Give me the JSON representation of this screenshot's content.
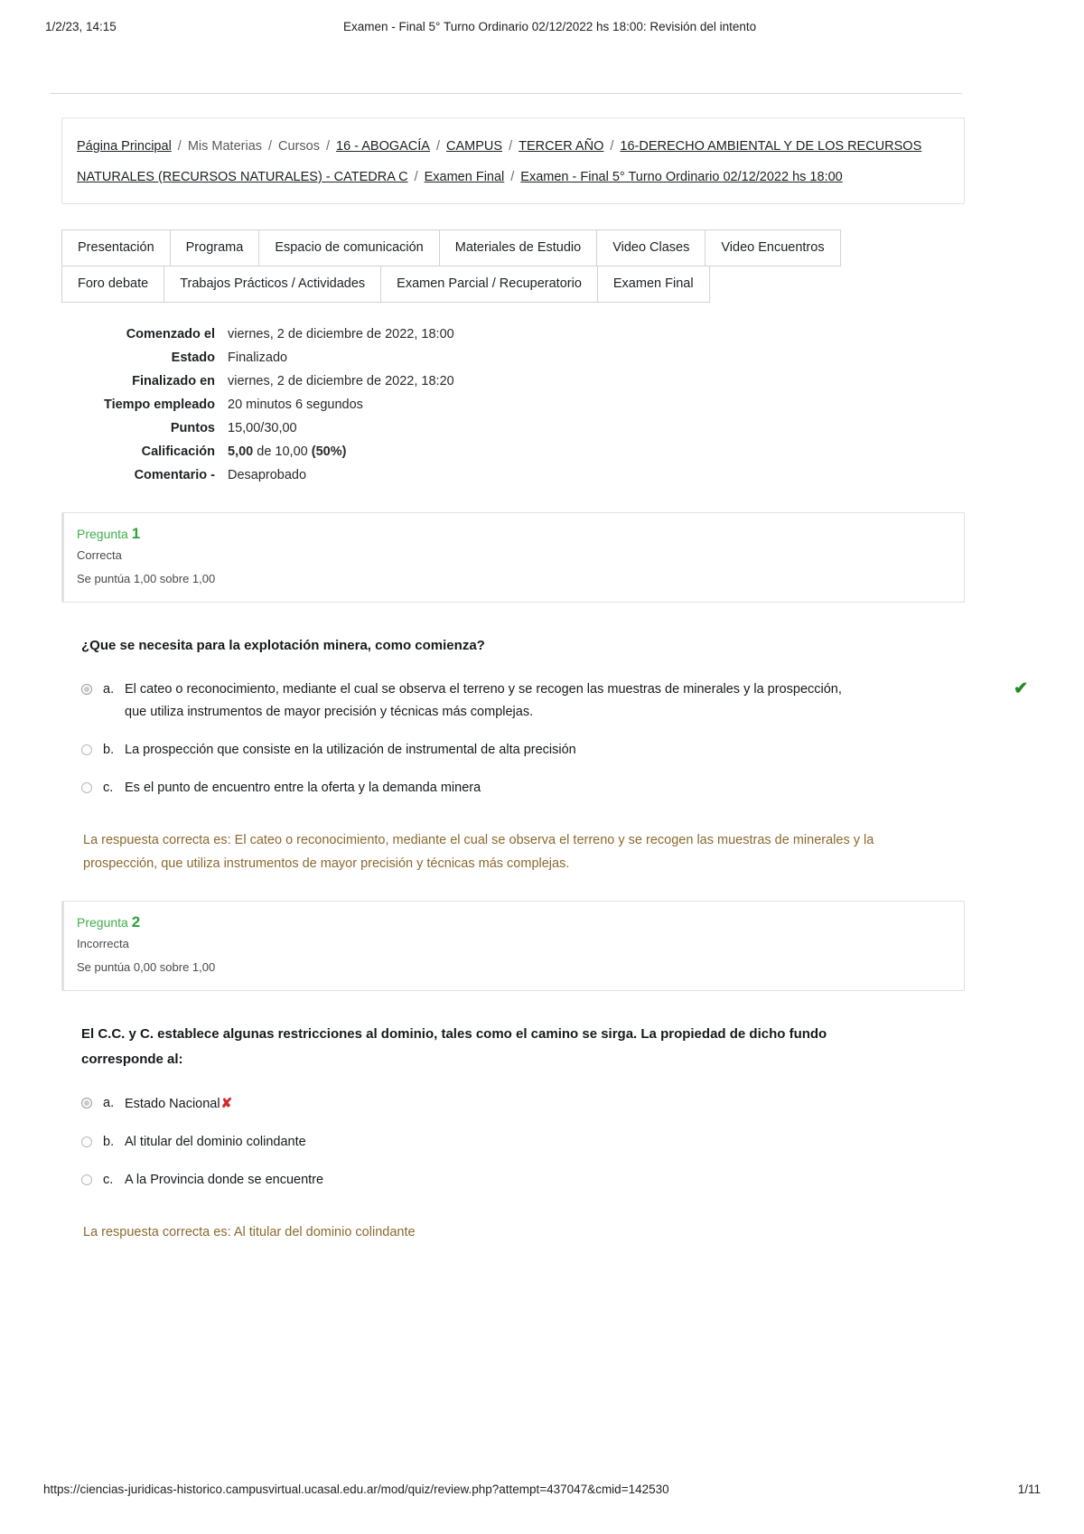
{
  "print": {
    "date": "1/2/23, 14:15",
    "title": "Examen - Final 5° Turno Ordinario 02/12/2022 hs 18:00: Revisión del intento",
    "url": "https://ciencias-juridicas-historico.campusvirtual.ucasal.edu.ar/mod/quiz/review.php?attempt=437047&cmid=142530",
    "page": "1/11"
  },
  "breadcrumb": {
    "items": [
      {
        "label": "Página Principal",
        "link": true
      },
      {
        "label": "Mis Materias",
        "link": false
      },
      {
        "label": "Cursos",
        "link": false
      },
      {
        "label": "16 - ABOGACÍA",
        "link": true
      },
      {
        "label": "CAMPUS",
        "link": true
      },
      {
        "label": "TERCER AÑO",
        "link": true
      },
      {
        "label": "16-DERECHO AMBIENTAL Y DE LOS RECURSOS NATURALES (RECURSOS NATURALES) - CATEDRA C",
        "link": true
      },
      {
        "label": "Examen Final",
        "link": true
      },
      {
        "label": "Examen - Final 5° Turno Ordinario 02/12/2022 hs 18:00",
        "link": true
      }
    ],
    "separator": "/"
  },
  "tabs": {
    "row1": [
      "Presentación",
      "Programa",
      "Espacio de comunicación",
      "Materiales de Estudio",
      "Video Clases",
      "Video Encuentros"
    ],
    "row2": [
      "Foro debate",
      "Trabajos Prácticos / Actividades",
      "Examen Parcial / Recuperatorio",
      "Examen Final"
    ]
  },
  "summary": {
    "rows": [
      {
        "label": "Comenzado el",
        "value": "viernes, 2 de diciembre de 2022, 18:00"
      },
      {
        "label": "Estado",
        "value": "Finalizado"
      },
      {
        "label": "Finalizado en",
        "value": "viernes, 2 de diciembre de 2022, 18:20"
      },
      {
        "label": "Tiempo empleado",
        "value": "20 minutos 6 segundos"
      },
      {
        "label": "Puntos",
        "value": "15,00/30,00"
      }
    ],
    "calificacion": {
      "label": "Calificación",
      "score": "5,00",
      "of": "de 10,00",
      "percent": "(50%)"
    },
    "comentario": {
      "label": "Comentario -",
      "value": "Desaprobado"
    }
  },
  "questions": [
    {
      "header_label": "Pregunta",
      "number": "1",
      "state": "Correcta",
      "grade": "Se puntúa 1,00 sobre 1,00",
      "text": "¿Que se necesita para la explotación minera, como comienza?",
      "options": [
        {
          "letter": "a.",
          "text": "El cateo o reconocimiento, mediante el cual se observa el terreno y se recogen las muestras de minerales y la prospección, que utiliza instrumentos de mayor precisión y técnicas más complejas.",
          "selected": true,
          "mark": "correct"
        },
        {
          "letter": "b.",
          "text": "La prospección que consiste en la utilización de instrumental de alta precisión",
          "selected": false,
          "mark": "none"
        },
        {
          "letter": "c.",
          "text": "Es el punto de encuentro entre la oferta y la demanda minera",
          "selected": false,
          "mark": "none"
        }
      ],
      "feedback": "La respuesta correcta es: El cateo o reconocimiento, mediante el cual se observa el terreno y se recogen las muestras de minerales y la prospección, que utiliza instrumentos de mayor precisión y técnicas más complejas."
    },
    {
      "header_label": "Pregunta",
      "number": "2",
      "state": "Incorrecta",
      "grade": "Se puntúa 0,00 sobre 1,00",
      "text": "El C.C. y C. establece algunas restricciones al dominio, tales como el camino se sirga. La propiedad de dicho fundo corresponde al:",
      "options": [
        {
          "letter": "a.",
          "text": "Estado Nacional",
          "selected": true,
          "mark": "wrong"
        },
        {
          "letter": "b.",
          "text": "Al titular del dominio colindante",
          "selected": false,
          "mark": "none"
        },
        {
          "letter": "c.",
          "text": "A la Provincia donde se encuentre",
          "selected": false,
          "mark": "none"
        }
      ],
      "feedback": "La respuesta correcta es: Al titular del dominio colindante"
    }
  ],
  "icons": {
    "correct_check": "✔",
    "wrong_cross": "✘"
  },
  "colors": {
    "question_label": "#3fae49",
    "feedback": "#8a6a2f",
    "correct": "#1f8b24",
    "wrong": "#cf2a27"
  }
}
